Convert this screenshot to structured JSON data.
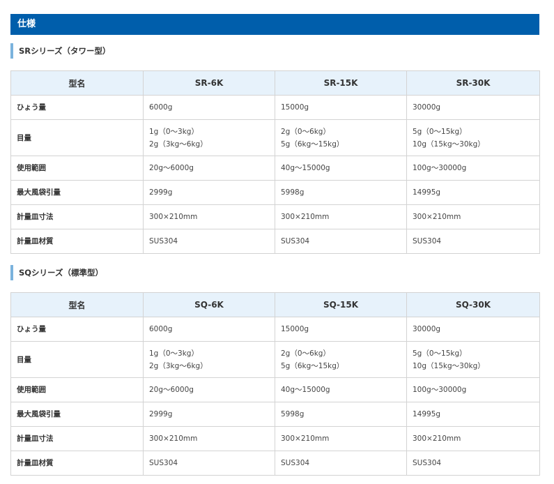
{
  "section_title": "仕様",
  "sr": {
    "subtitle": "SRシリーズ（タワー型）",
    "header": [
      "型名",
      "SR-6K",
      "SR-15K",
      "SR-30K"
    ],
    "rows": [
      {
        "label": "ひょう量",
        "cells": [
          [
            "6000g"
          ],
          [
            "15000g"
          ],
          [
            "30000g"
          ]
        ]
      },
      {
        "label": "目量",
        "cells": [
          [
            "1g（0〜3kg）",
            "2g（3kg〜6kg）"
          ],
          [
            "2g（0〜6kg）",
            "5g（6kg〜15kg）"
          ],
          [
            "5g（0〜15kg）",
            "10g（15kg〜30kg）"
          ]
        ]
      },
      {
        "label": "使用範囲",
        "cells": [
          [
            "20g〜6000g"
          ],
          [
            "40g〜15000g"
          ],
          [
            "100g〜30000g"
          ]
        ]
      },
      {
        "label": "最大風袋引量",
        "cells": [
          [
            "2999g"
          ],
          [
            "5998g"
          ],
          [
            "14995g"
          ]
        ]
      },
      {
        "label": "計量皿寸法",
        "cells": [
          [
            "300×210mm"
          ],
          [
            "300×210mm"
          ],
          [
            "300×210mm"
          ]
        ]
      },
      {
        "label": "計量皿材質",
        "cells": [
          [
            "SUS304"
          ],
          [
            "SUS304"
          ],
          [
            "SUS304"
          ]
        ]
      }
    ]
  },
  "sq": {
    "subtitle": "SQシリーズ（標準型）",
    "header": [
      "型名",
      "SQ-6K",
      "SQ-15K",
      "SQ-30K"
    ],
    "rows": [
      {
        "label": "ひょう量",
        "cells": [
          [
            "6000g"
          ],
          [
            "15000g"
          ],
          [
            "30000g"
          ]
        ]
      },
      {
        "label": "目量",
        "cells": [
          [
            "1g（0〜3kg）",
            "2g（3kg〜6kg）"
          ],
          [
            "2g（0〜6kg）",
            "5g（6kg〜15kg）"
          ],
          [
            "5g（0〜15kg）",
            "10g（15kg〜30kg）"
          ]
        ]
      },
      {
        "label": "使用範囲",
        "cells": [
          [
            "20g〜6000g"
          ],
          [
            "40g〜15000g"
          ],
          [
            "100g〜30000g"
          ]
        ]
      },
      {
        "label": "最大風袋引量",
        "cells": [
          [
            "2999g"
          ],
          [
            "5998g"
          ],
          [
            "14995g"
          ]
        ]
      },
      {
        "label": "計量皿寸法",
        "cells": [
          [
            "300×210mm"
          ],
          [
            "300×210mm"
          ],
          [
            "300×210mm"
          ]
        ]
      },
      {
        "label": "計量皿材質",
        "cells": [
          [
            "SUS304"
          ],
          [
            "SUS304"
          ],
          [
            "SUS304"
          ]
        ]
      }
    ]
  }
}
